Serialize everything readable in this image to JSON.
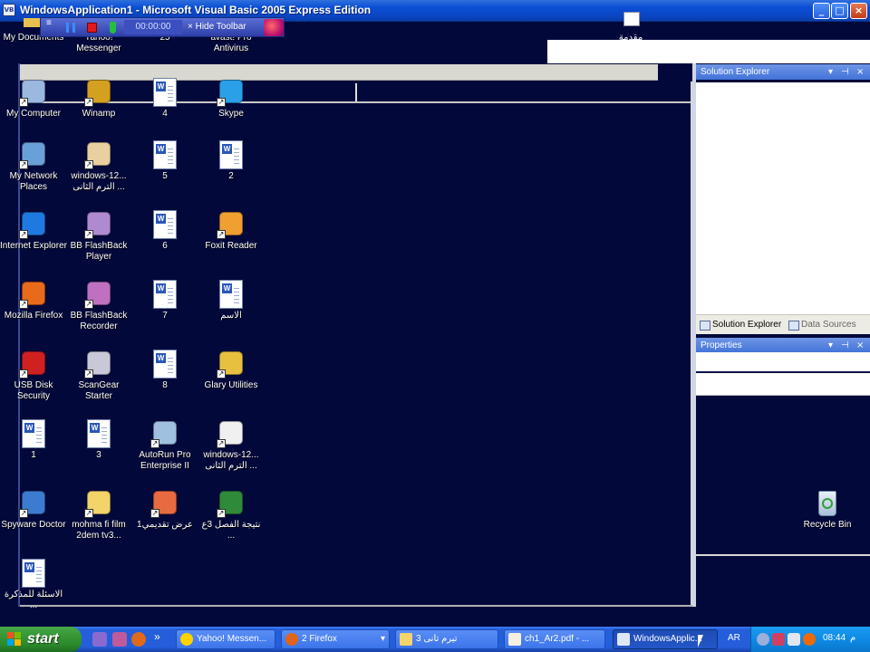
{
  "window": {
    "title": "WindowsApplication1 - Microsoft Visual Basic 2005 Express Edition",
    "icon_text": "VB",
    "controls": [
      "_",
      "□",
      "×"
    ]
  },
  "recorder_toolbar": {
    "timer": "00:00:00",
    "hide_label": "× Hide Toolbar"
  },
  "ide": {
    "solution_explorer": {
      "title": "Solution Explorer",
      "tabs": [
        "Solution Explorer",
        "Data Sources"
      ]
    },
    "properties": {
      "title": "Properties"
    },
    "panel_controls": [
      "▾",
      "⊣",
      "×"
    ],
    "partial_icon_label": "مقدمة"
  },
  "desktop": {
    "top_row_partial": [
      "My Documents",
      "Yahoo! Messenger",
      "25",
      "avast! Pro Antivirus"
    ],
    "icons": [
      {
        "label": "My Computer",
        "icon": "computer-icon"
      },
      {
        "label": "Winamp",
        "icon": "winamp-icon"
      },
      {
        "label": "4",
        "icon": "word-document-icon"
      },
      {
        "label": "Skype",
        "icon": "skype-icon"
      },
      {
        "label": "My Network Places",
        "icon": "network-icon"
      },
      {
        "label": "windows-12... الترم الثانى ...",
        "icon": "pdf-icon"
      },
      {
        "label": "5",
        "icon": "word-document-icon"
      },
      {
        "label": "2",
        "icon": "word-document-icon"
      },
      {
        "label": "Internet Explorer",
        "icon": "internet-explorer-icon"
      },
      {
        "label": "BB FlashBack Player",
        "icon": "flashback-player-icon"
      },
      {
        "label": "6",
        "icon": "word-document-icon"
      },
      {
        "label": "Foxit Reader",
        "icon": "foxit-reader-icon"
      },
      {
        "label": "Mozilla Firefox",
        "icon": "firefox-icon"
      },
      {
        "label": "BB FlashBack Recorder",
        "icon": "flashback-recorder-icon"
      },
      {
        "label": "7",
        "icon": "word-document-icon"
      },
      {
        "label": "الاسم",
        "icon": "word-document-icon"
      },
      {
        "label": "USB Disk Security",
        "icon": "usb-security-icon"
      },
      {
        "label": "ScanGear Starter",
        "icon": "scanner-icon"
      },
      {
        "label": "8",
        "icon": "word-document-icon"
      },
      {
        "label": "Glary Utilities",
        "icon": "glary-icon"
      },
      {
        "label": "1",
        "icon": "word-document-icon"
      },
      {
        "label": "3",
        "icon": "word-document-icon"
      },
      {
        "label": "AutoRun Pro Enterprise II",
        "icon": "autorun-icon"
      },
      {
        "label": "windows-12... الترم الثانى ...",
        "icon": "document-shortcut-icon"
      },
      {
        "label": "Spyware Doctor",
        "icon": "spyware-doctor-icon"
      },
      {
        "label": "mohma fi film 2dem tv3...",
        "icon": "folder-icon"
      },
      {
        "label": "عرض تقديمي1",
        "icon": "presentation-icon"
      },
      {
        "label": "نتيجة الفصل 3ع ...",
        "icon": "excel-icon"
      },
      {
        "label": "الاسئلة للمذكرة ...",
        "icon": "word-document-icon"
      }
    ],
    "recycle_bin": "Recycle Bin"
  },
  "taskbar": {
    "start": "start",
    "overflow": "»",
    "tasks": [
      {
        "label": "Yahoo! Messen...",
        "icon": "yahoo-icon"
      },
      {
        "label": "2 Firefox",
        "icon": "firefox-icon"
      },
      {
        "label": "3 تيرم تانى",
        "icon": "folder-icon"
      },
      {
        "label": "ch1_Ar2.pdf - ...",
        "icon": "pdf-icon"
      },
      {
        "label": "WindowsApplic...",
        "icon": "vb-icon"
      }
    ],
    "dropdown_marker": "▾",
    "language": "AR",
    "clock": "08:44",
    "ampm": "م"
  },
  "colors": {
    "desktop_bg": "#02083a",
    "titlebar": "#0b4fd6",
    "taskbar": "#245edb",
    "start_button": "#379a37",
    "tray": "#0e8ae6"
  }
}
